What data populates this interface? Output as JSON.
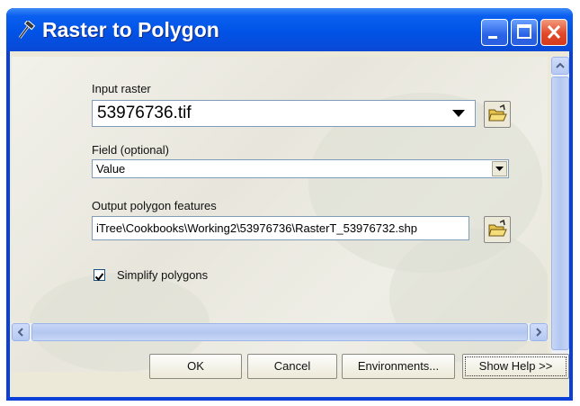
{
  "window": {
    "title": "Raster to Polygon",
    "title_icon": "hammer-icon",
    "controls": [
      "minimize-icon",
      "maximize-icon",
      "close-icon"
    ]
  },
  "form": {
    "input_raster": {
      "label": "Input raster",
      "value": "53976736.tif",
      "dropdown_icon": "dropdown-arrow-icon",
      "browse_icon": "open-folder-icon"
    },
    "field": {
      "label": "Field (optional)",
      "value": "Value",
      "dropdown_icon": "chevron-down-icon"
    },
    "output": {
      "label": "Output polygon features",
      "value": "iTree\\Cookbooks\\Working2\\53976736\\RasterT_53976732.shp",
      "browse_icon": "open-folder-icon"
    },
    "simplify": {
      "label": "Simplify polygons",
      "checked": true
    }
  },
  "buttons": {
    "ok": "OK",
    "cancel": "Cancel",
    "environments": "Environments...",
    "show_help": "Show Help >>"
  },
  "colors": {
    "titlebar": "#0053e6",
    "close_button": "#e1492a",
    "dialog_face": "#ece9d8"
  }
}
